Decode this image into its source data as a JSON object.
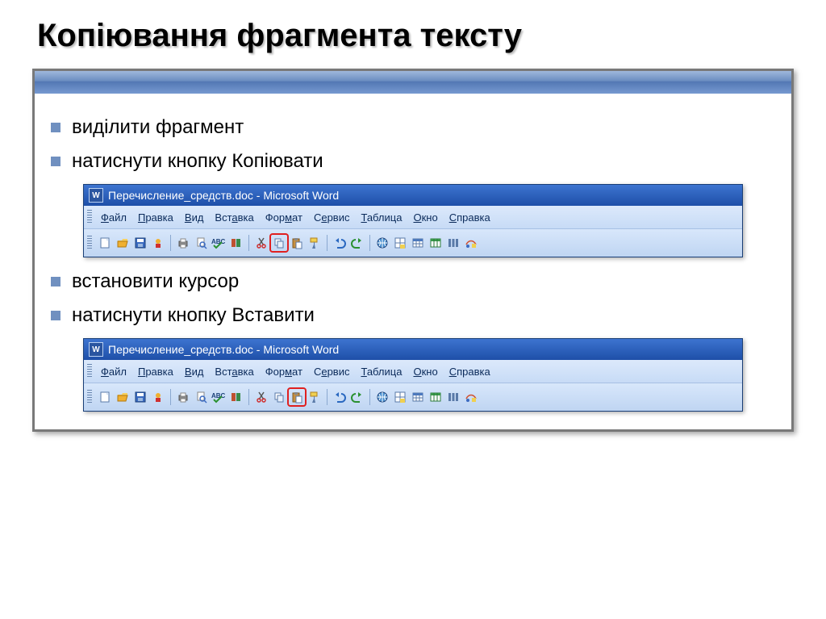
{
  "title": "Копіювання фрагмента тексту",
  "bullets": {
    "b1": "виділити фрагмент",
    "b2": "натиснути кнопку Копіювати",
    "b3": "встановити курсор",
    "b4": "натиснути кнопку Вставити"
  },
  "win": {
    "title": "Перечисление_средств.doc - Microsoft Word",
    "icon": "W"
  },
  "menu": {
    "m1": "Файл",
    "m2": "Правка",
    "m3": "Вид",
    "m4": "Вставка",
    "m5": "Формат",
    "m6": "Сервис",
    "m7": "Таблица",
    "m8": "Окно",
    "m9": "Справка"
  },
  "icons": {
    "new": "new-doc",
    "open": "open",
    "save": "save",
    "perm": "permission",
    "print": "print",
    "preview": "preview",
    "spell": "spelling",
    "research": "research",
    "cut": "cut",
    "copy": "copy",
    "paste": "paste",
    "fmt": "format-painter",
    "undo": "undo",
    "redo": "redo",
    "link": "hyperlink",
    "tbb": "tables-borders",
    "tbl": "insert-table",
    "xl": "excel",
    "cols": "columns",
    "draw": "drawing"
  }
}
